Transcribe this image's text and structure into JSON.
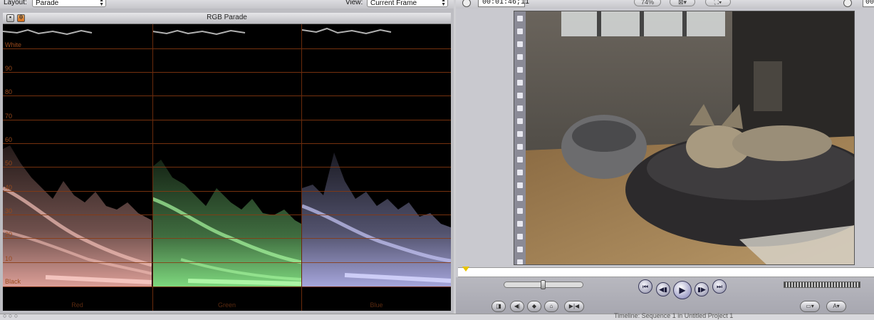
{
  "scope_toolbar": {
    "layout_label": "Layout:",
    "layout_value": "Parade",
    "view_label": "View:",
    "view_value": "Current Frame"
  },
  "scope": {
    "title": "RGB Parade",
    "gridlines": [
      "White",
      "90",
      "80",
      "70",
      "60",
      "50",
      "40",
      "30",
      "20",
      "10",
      "Black"
    ],
    "channels": [
      {
        "name": "Red",
        "color": "#f4b0a8"
      },
      {
        "name": "Green",
        "color": "#8cf08c"
      },
      {
        "name": "Blue",
        "color": "#b8b8f4"
      }
    ],
    "gridline_color": "#8a3a10"
  },
  "viewer_toolbar": {
    "timecode": "00:01:46;11",
    "zoom": "74%",
    "timecode_right": "00"
  },
  "bottom": {
    "left_text": "○ ○ ○",
    "center_text": "Timeline: Sequence 1 in Untitled Project 1"
  },
  "icons": {
    "clock": "clock-icon",
    "gear": "gear-icon",
    "play": "play-icon",
    "skip_back": "skip-back-icon",
    "skip_forward": "skip-forward-icon"
  }
}
